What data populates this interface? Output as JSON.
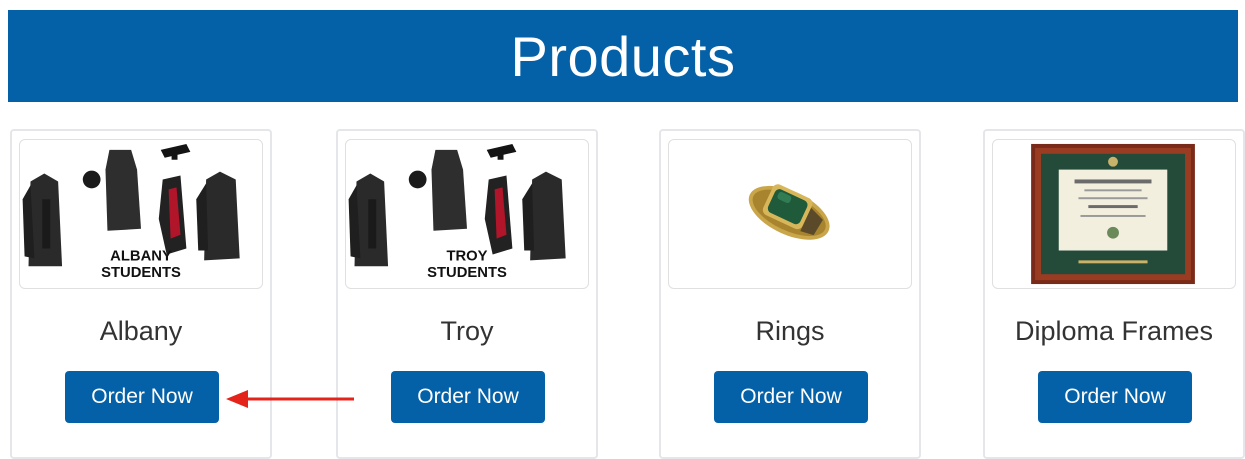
{
  "header": {
    "title": "Products"
  },
  "products": [
    {
      "name": "Albany",
      "image_caption": [
        "ALBANY",
        "STUDENTS"
      ],
      "button": "Order Now"
    },
    {
      "name": "Troy",
      "image_caption": [
        "TROY",
        "STUDENTS"
      ],
      "button": "Order Now"
    },
    {
      "name": "Rings",
      "button": "Order Now"
    },
    {
      "name": "Diploma Frames",
      "button": "Order Now"
    }
  ],
  "colors": {
    "brand_blue": "#0561a7",
    "annotation_arrow": "#e4231b"
  }
}
